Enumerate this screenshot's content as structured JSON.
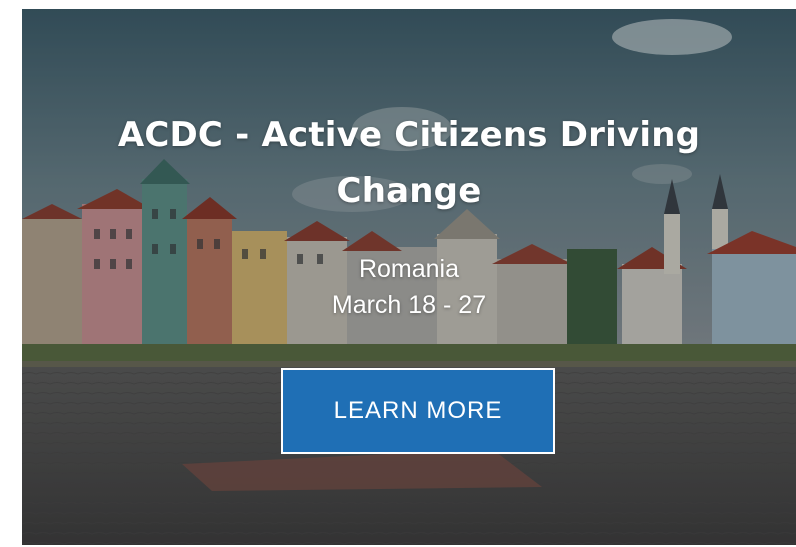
{
  "hero": {
    "title": "ACDC - Active Citizens Driving Change",
    "location": "Romania",
    "dates": "March 18 - 27",
    "cta_label": "LEARN MORE"
  },
  "colors": {
    "button_background": "#1f6fb5",
    "button_border": "#ffffff",
    "text": "#ffffff"
  }
}
